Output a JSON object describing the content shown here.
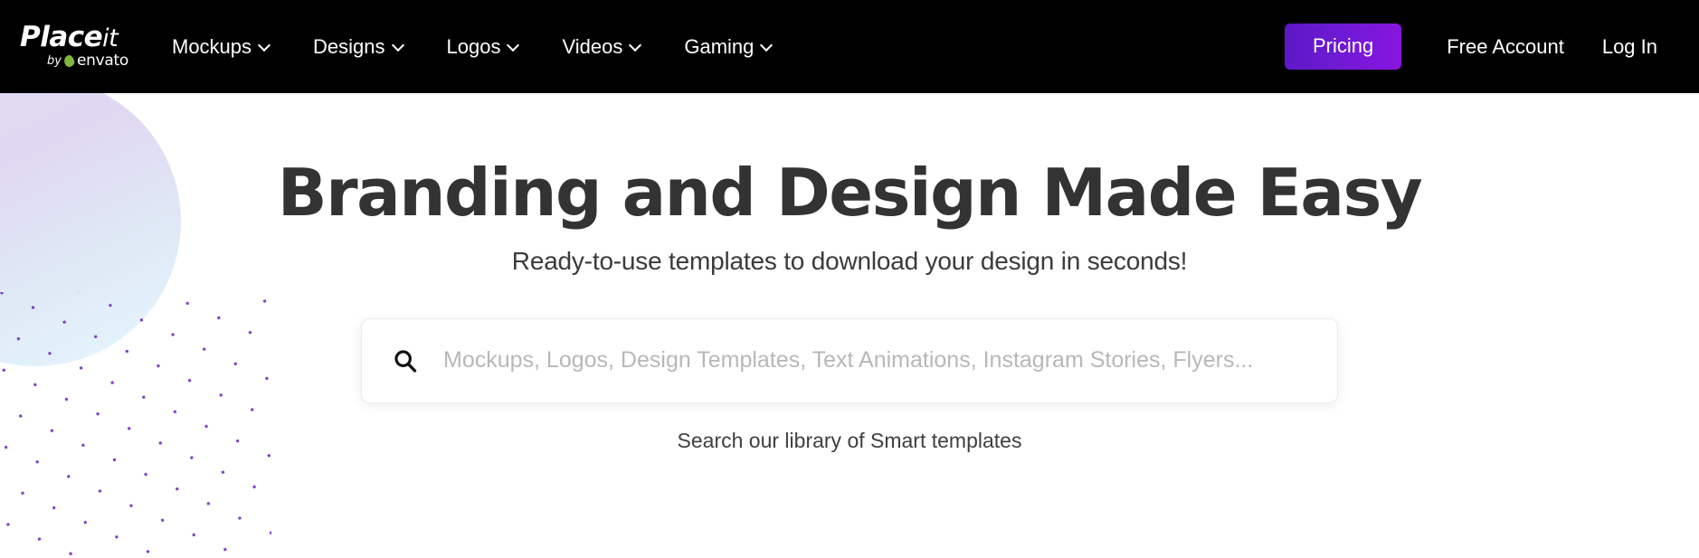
{
  "brand": {
    "logo_main": "Place",
    "logo_main_italic": "it",
    "logo_by": "by",
    "logo_envato": "envato",
    "leaf_color": "#82b541"
  },
  "nav": {
    "items": [
      {
        "label": "Mockups",
        "has_dropdown": true,
        "icon": "chevron-down-icon"
      },
      {
        "label": "Designs",
        "has_dropdown": true,
        "icon": "chevron-down-icon"
      },
      {
        "label": "Logos",
        "has_dropdown": true,
        "icon": "chevron-down-icon"
      },
      {
        "label": "Videos",
        "has_dropdown": true,
        "icon": "chevron-down-icon"
      },
      {
        "label": "Gaming",
        "has_dropdown": true,
        "icon": "chevron-down-icon"
      }
    ]
  },
  "header_actions": {
    "pricing_label": "Pricing",
    "pricing_gradient_from": "#5b18c4",
    "pricing_gradient_to": "#8b14e0",
    "free_account_label": "Free Account",
    "log_in_label": "Log In",
    "background_color": "#000000"
  },
  "hero": {
    "title": "Branding and Design Made Easy",
    "subtitle": "Ready-to-use templates to download your design in seconds!",
    "title_color": "#333333"
  },
  "search": {
    "icon": "search-icon",
    "value": "",
    "placeholder": "Mockups, Logos, Design Templates, Text Animations, Instagram Stories, Flyers...",
    "note": "Search our library of Smart templates"
  },
  "decor": {
    "circle_gradient_from": "#e3dcf3",
    "circle_gradient_to": "#eff8fd",
    "dot_color": "#7b3fc4"
  }
}
